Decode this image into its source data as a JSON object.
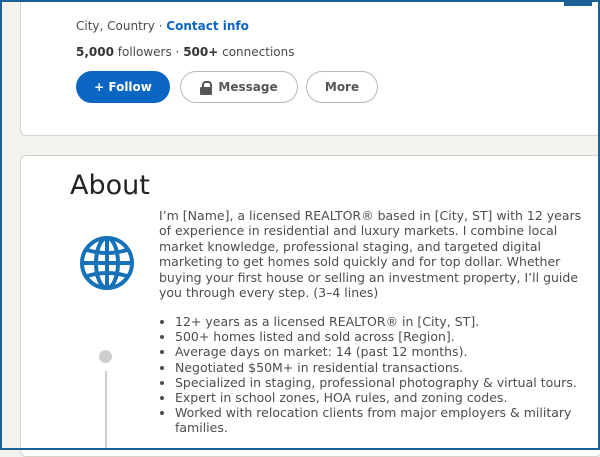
{
  "profile": {
    "location": "City, Country",
    "separator": " · ",
    "contact_link": "Contact info",
    "followers_count": "5,000",
    "followers_label": " followers · ",
    "connections_count": "500+",
    "connections_label": " connections"
  },
  "actions": {
    "follow_label": "+ Follow",
    "message_label": "Message",
    "more_label": "More"
  },
  "about": {
    "title": "About",
    "bio": "I’m [Name], a licensed REALTOR® based in [City, ST] with 12 years of experience in residential and luxury markets. I combine local market knowledge, professional staging, and targeted digital marketing to get homes sold quickly and for top dollar. Whether buying your first house or selling an investment property, I’ll guide you through every step. (3–4 lines)",
    "highlights": [
      "12+ years as a licensed REALTOR® in [City, ST].",
      "500+ homes listed and sold across [Region].",
      "Average days on market: 14 (past 12 months).",
      "Negotiated $50M+ in residential transactions.",
      "Specialized in staging, professional photography & virtual tours.",
      "Expert in school zones, HOA rules, and zoning codes.",
      "Worked with relocation clients from major employers & military families."
    ]
  },
  "icons": {
    "globe": "globe-icon",
    "lock": "lock-icon"
  },
  "colors": {
    "accent": "#0a66c2",
    "globe": "#1672b8",
    "border": "#1f5f97"
  }
}
